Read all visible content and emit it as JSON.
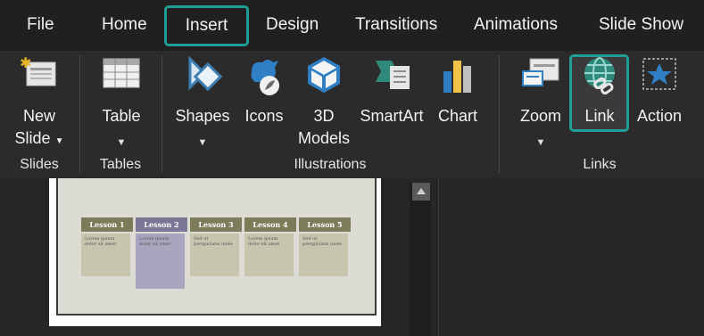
{
  "tabs": [
    "File",
    "Home",
    "Insert",
    "Design",
    "Transitions",
    "Animations",
    "Slide Show"
  ],
  "active_tab": "Insert",
  "ribbon": {
    "slides": {
      "new_slide_line1": "New",
      "new_slide_line2": "Slide",
      "group": "Slides"
    },
    "tables": {
      "table": "Table",
      "group": "Tables"
    },
    "illustrations": {
      "shapes": "Shapes",
      "icons": "Icons",
      "models_line1": "3D",
      "models_line2": "Models",
      "smartart": "SmartArt",
      "chart": "Chart",
      "group": "Illustrations"
    },
    "links": {
      "zoom": "Zoom",
      "link": "Link",
      "action": "Action",
      "group": "Links"
    }
  },
  "slide": {
    "lessons": [
      "Lesson 1",
      "Lesson 2",
      "Lesson 3",
      "Lesson 4",
      "Lesson 5"
    ],
    "cards": [
      "Lorem ipsum dolor sit amet",
      "Lorem ipsum dolor sit amet",
      "Sed ut perspiciatis unde",
      "Lorem ipsum dolor sit amet",
      "Sed ut perspiciatis unde"
    ]
  },
  "colors": {
    "accent": "#1f9e96",
    "tab_bar": "#202020",
    "ribbon": "#2b2b2b"
  },
  "icons": [
    "new-slide-icon",
    "table-icon",
    "shapes-icon",
    "icons-icon",
    "3d-models-icon",
    "smartart-icon",
    "chart-icon",
    "zoom-icon",
    "link-icon",
    "action-icon"
  ]
}
